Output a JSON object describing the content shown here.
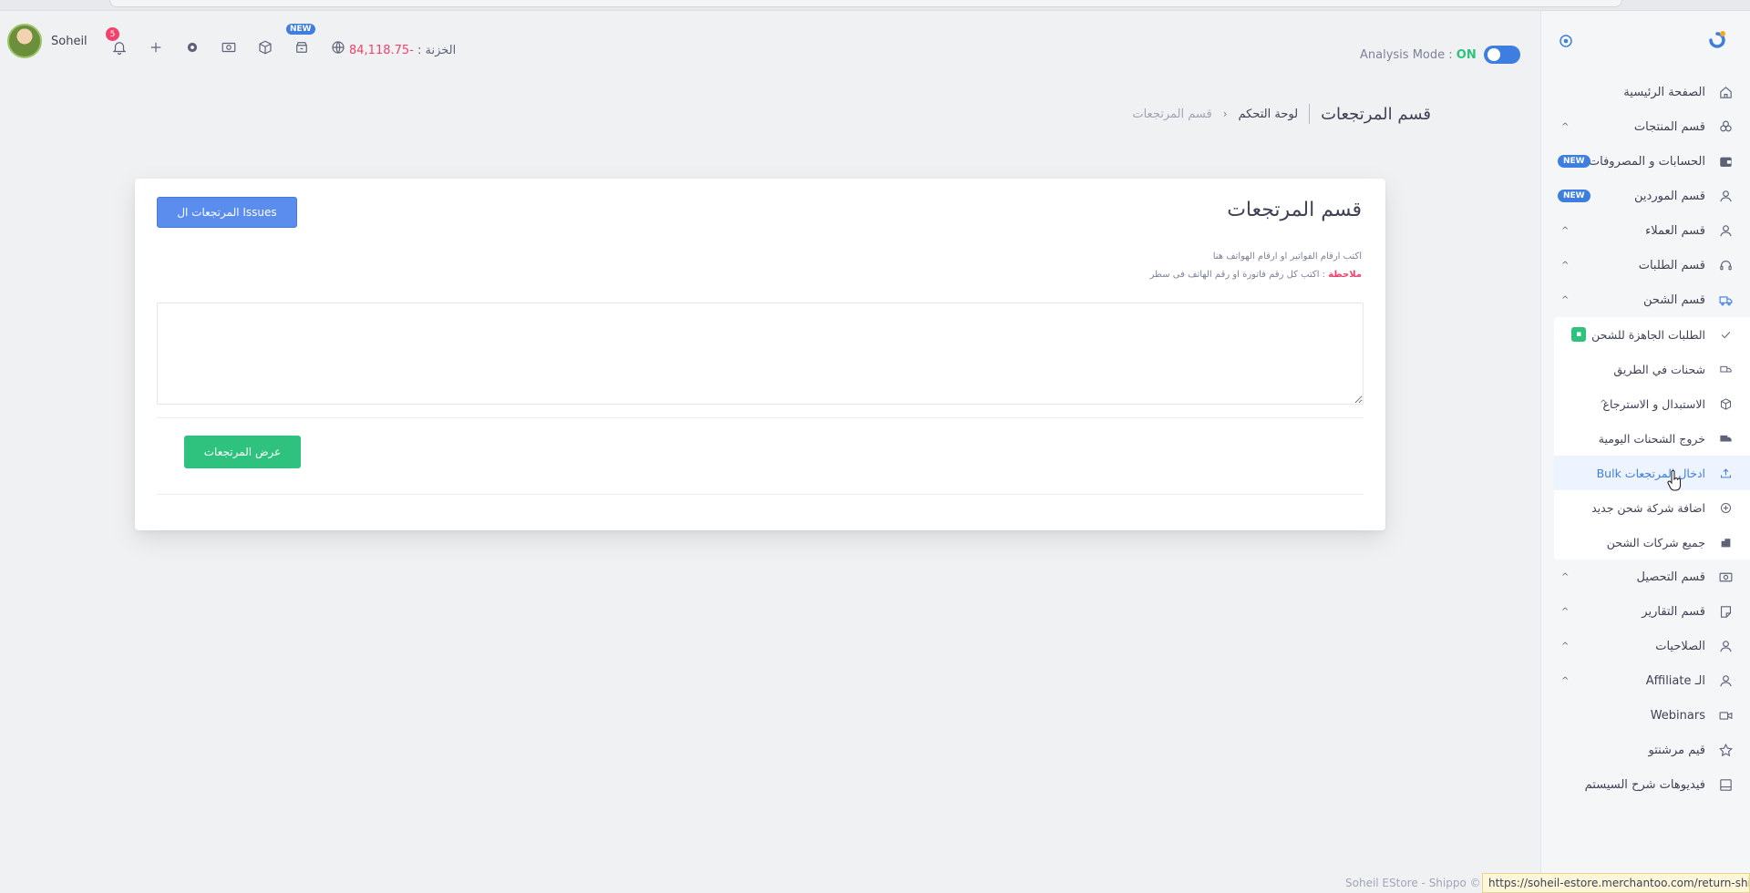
{
  "header": {
    "username": "Soheil",
    "notification_count": "5",
    "new_badge": "NEW",
    "treasury_label": "الخزنة :",
    "treasury_value": "-84,118.75",
    "analysis_label": "Analysis Mode :",
    "analysis_state": "ON"
  },
  "breadcrumb": {
    "title": "قسم المرتجعات",
    "home": "لوحة التحكم",
    "current": "قسم المرتجعات"
  },
  "card": {
    "title": "قسم المرتجعات",
    "issues_button": "المرتجعات ال Issues",
    "hint_line": "اكتب ارقام الفواتير او ارقام الهواتف هنا",
    "note_label": "ملاحظة",
    "note_text": " : اكتب كل رقم فاتورة او رقم الهاتف فى سطر",
    "textarea_value": "",
    "show_button": "عرض المرتجعات"
  },
  "sidebar": {
    "items": [
      {
        "label": "الصفحة الرئيسية",
        "icon": "home-icon"
      },
      {
        "label": "قسم المنتجات",
        "icon": "products-icon",
        "caret": "^"
      },
      {
        "label": "الحسابات و المصروفات",
        "icon": "wallet-icon",
        "badge": "NEW"
      },
      {
        "label": "قسم الموردين",
        "icon": "user-icon",
        "badge": "NEW"
      },
      {
        "label": "قسم العملاء",
        "icon": "user-icon",
        "caret": "^"
      },
      {
        "label": "قسم الطلبات",
        "icon": "headset-icon",
        "caret": "^"
      },
      {
        "label": "قسم الشحن",
        "icon": "truck-icon",
        "caret": "^"
      }
    ],
    "shipping_sub": [
      {
        "label": "الطلبات الجاهزة للشحن",
        "icon": "check-icon"
      },
      {
        "label": "شحنات في الطريق",
        "icon": "truck-icon"
      },
      {
        "label": "الاستبدال و الاسترجاع",
        "icon": "box-icon",
        "caret": "^"
      },
      {
        "label": "خروج الشحنات اليومية",
        "icon": "truck-icon"
      },
      {
        "label": "ادخال المرتجعات Bulk",
        "icon": "upload-icon"
      },
      {
        "label": "اضافة شركة شحن جديد",
        "icon": "plus-circle-icon"
      },
      {
        "label": "جميع شركات الشحن",
        "icon": "building-icon"
      }
    ],
    "items_after": [
      {
        "label": "قسم التحصيل",
        "icon": "cash-icon",
        "caret": "^"
      },
      {
        "label": "قسم التقارير",
        "icon": "report-icon",
        "caret": "^"
      },
      {
        "label": "الصلاحيات",
        "icon": "user-icon",
        "caret": "^"
      },
      {
        "label": "الـ Affiliate",
        "icon": "user-icon",
        "caret": "^"
      },
      {
        "label": "Webinars",
        "icon": "video-icon"
      },
      {
        "label": "قيم مرشنتو",
        "icon": "star-icon"
      },
      {
        "label": "فيديوهات شرح السيستم",
        "icon": "book-icon"
      }
    ]
  },
  "footer": {
    "text": "Soheil EStore - Shippo ©",
    "status_url": "https://soheil-estore.merchantoo.com/return-shipme"
  },
  "colors": {
    "primary": "#3d7ee0",
    "success": "#2ec27e",
    "danger": "#f1416c"
  }
}
